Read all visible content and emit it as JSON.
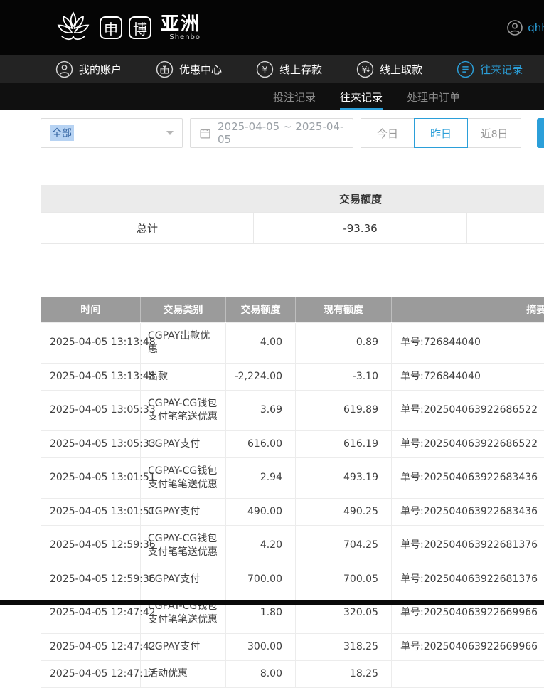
{
  "colors": {
    "accent": "#2b9fd9"
  },
  "header": {
    "logo": {
      "char1": "申",
      "char2": "博",
      "suffix": "亚洲",
      "subtitle": "Shenbo"
    },
    "user": {
      "name": "qhhw"
    }
  },
  "nav": {
    "items": [
      {
        "label": "我的账户",
        "icon": "account-icon"
      },
      {
        "label": "优惠中心",
        "icon": "promo-icon"
      },
      {
        "label": "线上存款",
        "icon": "deposit-icon"
      },
      {
        "label": "线上取款",
        "icon": "withdraw-icon"
      },
      {
        "label": "往来记录",
        "icon": "records-icon"
      }
    ]
  },
  "subnav": {
    "items": [
      {
        "label": "投注记录"
      },
      {
        "label": "往来记录"
      },
      {
        "label": "处理中订单"
      }
    ]
  },
  "filters": {
    "type_select": "全部",
    "date_range": "2025-04-05 ~ 2025-04-05",
    "quick_buttons": [
      {
        "label": "今日"
      },
      {
        "label": "昨日"
      },
      {
        "label": "近8日"
      }
    ]
  },
  "summary": {
    "header": "交易额度",
    "total_label": "总计",
    "total_value": "-93.36"
  },
  "table": {
    "columns": [
      "时间",
      "交易类别",
      "交易额度",
      "现有额度",
      "摘要"
    ],
    "rows": [
      [
        "2025-04-05 13:13:48",
        "CGPAY出款优惠",
        "4.00",
        "0.89",
        "单号:726844040"
      ],
      [
        "2025-04-05 13:13:48",
        "出款",
        "-2,224.00",
        "-3.10",
        "单号:726844040"
      ],
      [
        "2025-04-05 13:05:33",
        "CGPAY-CG钱包支付笔笔送优惠",
        "3.69",
        "619.89",
        "单号:202504063922686522"
      ],
      [
        "2025-04-05 13:05:33",
        "CGPAY支付",
        "616.00",
        "616.19",
        "单号:202504063922686522"
      ],
      [
        "2025-04-05 13:01:51",
        "CGPAY-CG钱包支付笔笔送优惠",
        "2.94",
        "493.19",
        "单号:202504063922683436"
      ],
      [
        "2025-04-05 13:01:51",
        "CGPAY支付",
        "490.00",
        "490.25",
        "单号:202504063922683436"
      ],
      [
        "2025-04-05 12:59:36",
        "CGPAY-CG钱包支付笔笔送优惠",
        "4.20",
        "704.25",
        "单号:202504063922681376"
      ],
      [
        "2025-04-05 12:59:36",
        "CGPAY支付",
        "700.00",
        "700.05",
        "单号:202504063922681376"
      ],
      [
        "2025-04-05 12:47:42",
        "CGPAY-CG钱包支付笔笔送优惠",
        "1.80",
        "320.05",
        "单号:202504063922669966"
      ],
      [
        "2025-04-05 12:47:42",
        "CGPAY支付",
        "300.00",
        "318.25",
        "单号:202504063922669966"
      ],
      [
        "2025-04-05 12:47:17",
        "活动优惠",
        "8.00",
        "18.25",
        ""
      ]
    ]
  }
}
